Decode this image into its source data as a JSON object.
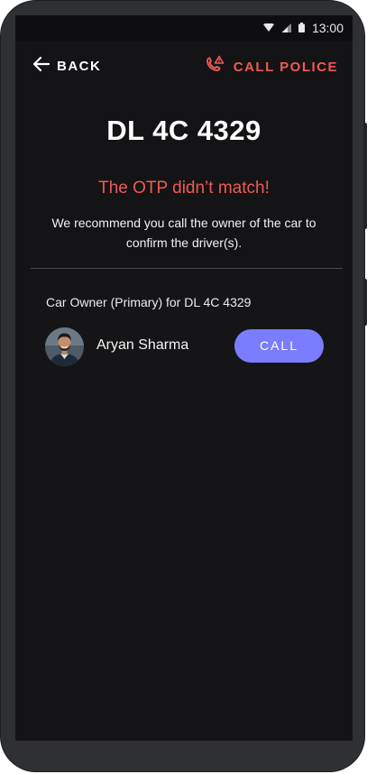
{
  "status_bar": {
    "time": "13:00",
    "icons": [
      "wifi-icon",
      "signal-icon",
      "battery-icon"
    ]
  },
  "nav": {
    "back_label": "BACK",
    "back_icon": "arrow-left-icon",
    "police_label": "CALL POLICE",
    "police_icon": "phone-alert-icon"
  },
  "vehicle": {
    "plate": "DL 4C 4329"
  },
  "alert": {
    "title": "The OTP didn’t match!",
    "message": "We recommend you call the owner of the car to confirm the driver(s)."
  },
  "owner": {
    "label": "Car Owner (Primary) for DL 4C 4329",
    "name": "Aryan Sharma",
    "call_label": "CALL"
  },
  "colors": {
    "accent_red": "#ef5a55",
    "call_button": "#7b7dff",
    "background": "#141416"
  }
}
